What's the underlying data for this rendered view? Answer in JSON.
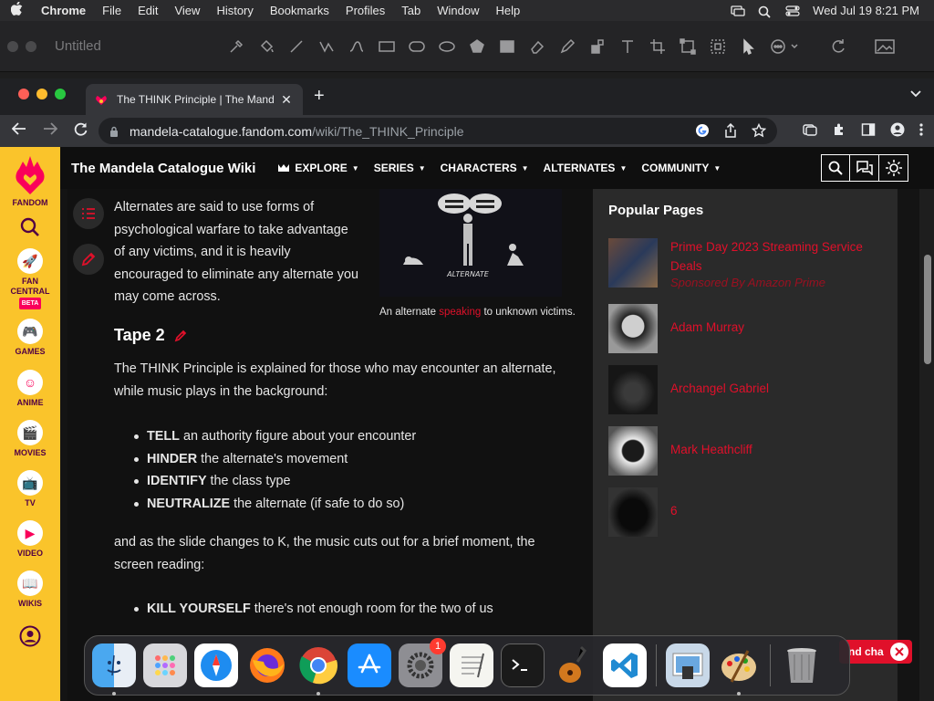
{
  "menubar": {
    "app": "Chrome",
    "items": [
      "File",
      "Edit",
      "View",
      "History",
      "Bookmarks",
      "Profiles",
      "Tab",
      "Window",
      "Help"
    ],
    "clock": "Wed Jul 19  8:21 PM"
  },
  "drawbar": {
    "title": "Untitled"
  },
  "browser": {
    "tab_title": "The THINK Principle | The Mand",
    "url_host": "mandela-catalogue.fandom.com",
    "url_path": "/wiki/The_THINK_Principle"
  },
  "fandom_rail": {
    "items": [
      {
        "label": "FANDOM",
        "icon": "fandom-heart-icon"
      },
      {
        "label": "",
        "icon": "search-icon"
      },
      {
        "label": "FAN CENTRAL",
        "icon": "rocket-icon",
        "badge": "BETA"
      },
      {
        "label": "GAMES",
        "icon": "gamepad-icon"
      },
      {
        "label": "ANIME",
        "icon": "anime-icon"
      },
      {
        "label": "MOVIES",
        "icon": "clapper-icon"
      },
      {
        "label": "TV",
        "icon": "tv-icon"
      },
      {
        "label": "VIDEO",
        "icon": "play-icon"
      },
      {
        "label": "WIKIS",
        "icon": "book-icon"
      }
    ]
  },
  "wiki_header": {
    "title": "The Mandela Catalogue Wiki",
    "nav": [
      "EXPLORE",
      "SERIES",
      "CHARACTERS",
      "ALTERNATES",
      "COMMUNITY"
    ]
  },
  "article": {
    "para1": "Alternates are said to use forms of psychological warfare to take advantage of any victims, and it is heavily encouraged to eliminate any alternate you may come across.",
    "figure_label": "ALTERNATE",
    "caption_pre": "An alternate ",
    "caption_link": "speaking",
    "caption_post": " to unknown victims.",
    "heading": "Tape 2",
    "para2": "The THINK Principle is explained for those who may encounter an alternate, while music plays in the background:",
    "bullets": [
      {
        "bold": "TELL",
        "rest": " an authority figure about your encounter"
      },
      {
        "bold": "HINDER",
        "rest": " the alternate's movement"
      },
      {
        "bold": "IDENTIFY",
        "rest": " the class type"
      },
      {
        "bold": "NEUTRALIZE",
        "rest": " the alternate (if safe to do so)"
      }
    ],
    "para3": "and as the slide changes to K, the music cuts out for a brief moment, the screen reading:",
    "bullets2": [
      {
        "bold": "KILL YOURSELF",
        "rest": " there's not enough room for the two of us"
      }
    ]
  },
  "popular": {
    "title": "Popular Pages",
    "items": [
      {
        "title": "Prime Day 2023 Streaming Service Deals",
        "sub": "Sponsored By Amazon Prime"
      },
      {
        "title": "Adam Murray"
      },
      {
        "title": "Archangel Gabriel"
      },
      {
        "title": "Mark Heathcliff"
      },
      {
        "title": "6"
      }
    ]
  },
  "chat": {
    "label": "nd cha"
  },
  "dock": {
    "apps": [
      "finder",
      "launchpad",
      "safari",
      "firefox",
      "chrome",
      "app-store",
      "system-settings",
      "textedit",
      "terminal",
      "garageband",
      "vscode",
      "preview",
      "paintbrush",
      "trash"
    ],
    "settings_badge": "1"
  },
  "colors": {
    "fandom_yellow": "#fac42b",
    "fandom_pink": "#fa005a",
    "link_red": "#e0102a"
  }
}
